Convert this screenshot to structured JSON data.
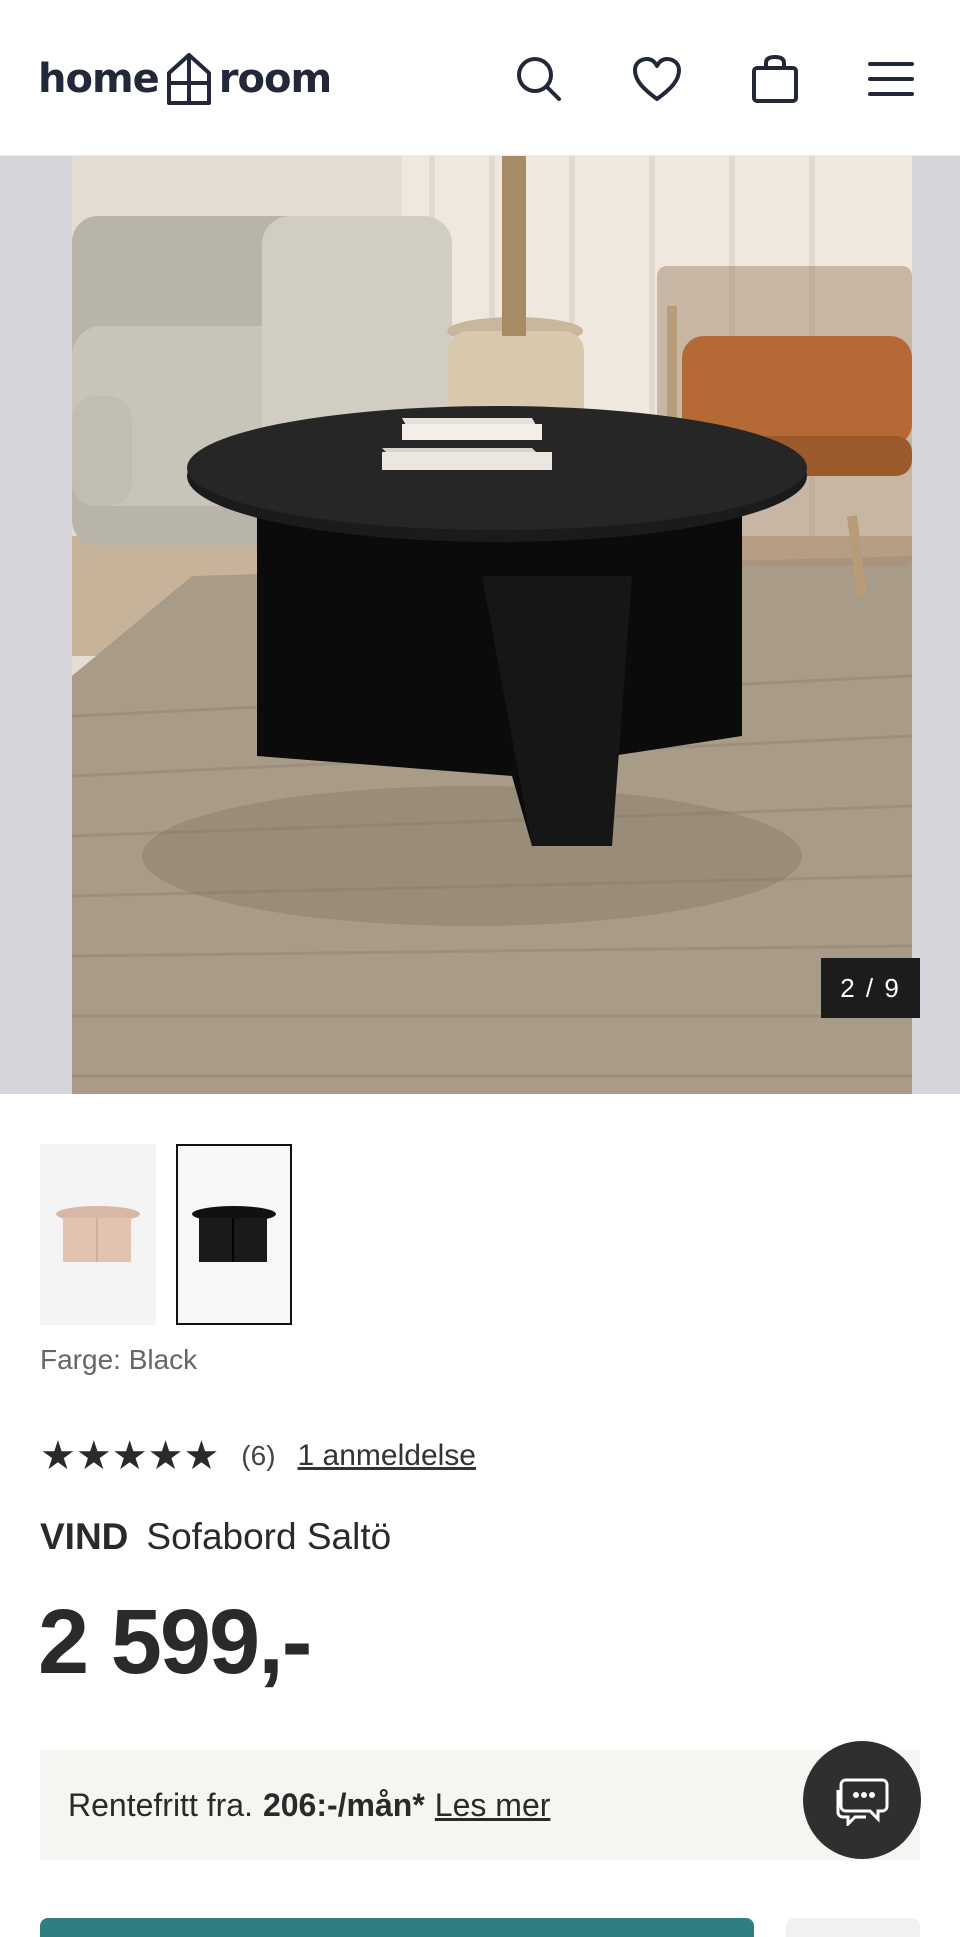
{
  "header": {
    "logo_left": "home",
    "logo_right": "room",
    "icons": [
      "search-icon",
      "heart-icon",
      "bag-icon",
      "menu-icon"
    ]
  },
  "gallery": {
    "counter": "2 / 9"
  },
  "product": {
    "color_label": "Farge: Black",
    "rating_stars": "★★★★★",
    "rating_value": 5,
    "rating_count": "(6)",
    "review_link": "1 anmeldelse",
    "brand": "VIND",
    "name": "Sofabord Saltö",
    "price": "2 599,-"
  },
  "finance": {
    "prefix": "Rentefritt fra.",
    "amount": "206:-/mån*",
    "link": "Les mer"
  },
  "colors": {
    "accent": "#2d7f80",
    "dark": "#2f2f2f"
  }
}
